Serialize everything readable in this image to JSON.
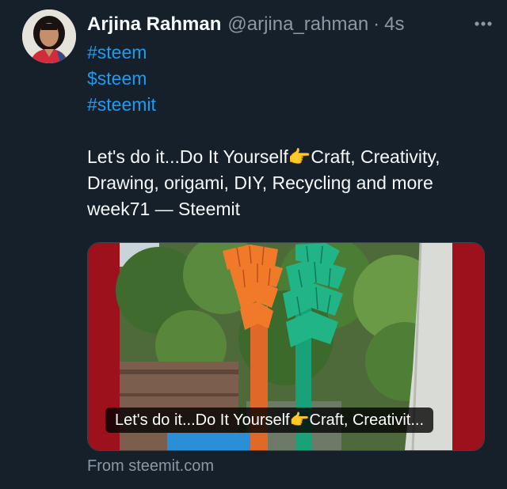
{
  "author": {
    "name": "Arjina Rahman",
    "handle": "@arjina_rahman",
    "separator": "·",
    "time": "4s"
  },
  "tweet": {
    "tags": [
      "#steem",
      "$steem",
      "#steemit"
    ],
    "text_before_emoji": "Let's do it...Do It Yourself",
    "emoji": "👉",
    "text_after_emoji": "Craft, Creativity, Drawing, origami, DIY, Recycling and more week71 — Steemit"
  },
  "card": {
    "caption_before_emoji": "Let's do it...Do It Yourself",
    "caption_emoji": "👉",
    "caption_after_emoji": "Craft, Creativit...",
    "source": "From steemit.com"
  },
  "icons": {
    "more": "more-horizontal-icon",
    "avatar": "user-avatar"
  },
  "colors": {
    "background": "#15202b",
    "link": "#1d9bf0",
    "muted": "#8b98a5",
    "text": "#f7f9f9"
  }
}
